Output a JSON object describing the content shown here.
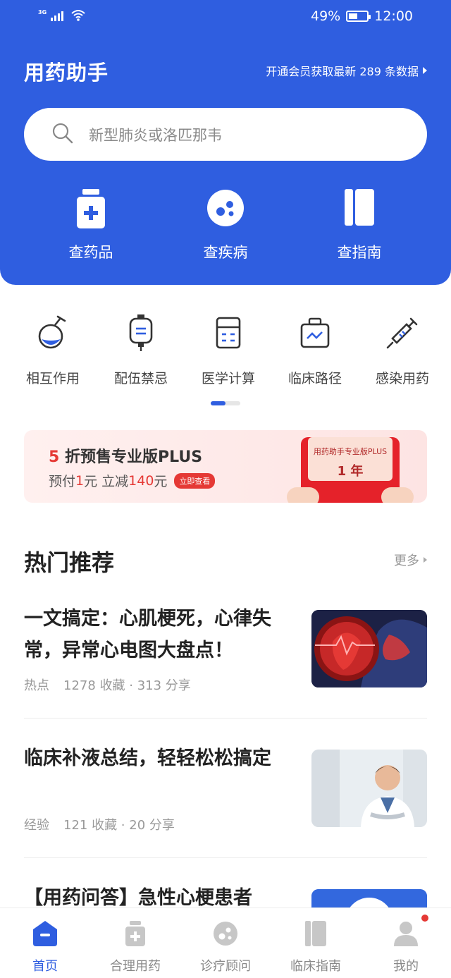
{
  "status_bar": {
    "network": "3G",
    "battery": "49%",
    "time": "12:00",
    "battery_level": 0.49
  },
  "header": {
    "app_title": "用药助手",
    "member_link": "开通会员获取最新 289 条数据"
  },
  "search": {
    "placeholder": "新型肺炎或洛匹那韦"
  },
  "quick_actions": [
    {
      "label": "查药品",
      "icon": "medicine-bottle-icon"
    },
    {
      "label": "查疾病",
      "icon": "virus-icon"
    },
    {
      "label": "查指南",
      "icon": "book-icon"
    }
  ],
  "tools": [
    {
      "label": "相互作用",
      "icon": "flask-icon"
    },
    {
      "label": "配伍禁忌",
      "icon": "iv-bag-icon"
    },
    {
      "label": "医学计算",
      "icon": "calculator-icon"
    },
    {
      "label": "临床路径",
      "icon": "kit-icon"
    },
    {
      "label": "感染用药",
      "icon": "syringe-icon"
    }
  ],
  "pager": {
    "pages": 2,
    "current": 1
  },
  "promo": {
    "discount": "5",
    "title_rest": " 折预售专业版PLUS",
    "prepay_pre": "预付 ",
    "prepay_amount": "1",
    "prepay_mid": " 元 立减 ",
    "reduce_amount": "140",
    "prepay_post": " 元",
    "badge": "立即查看",
    "card_title": "用药助手专业版PLUS",
    "card_term": "1 年"
  },
  "section": {
    "title": "热门推荐",
    "more": "更多"
  },
  "articles": [
    {
      "title": "一文搞定：心肌梗死，心律失常，异常心电图大盘点！",
      "tag": "热点",
      "stats": "1278 收藏 · 313 分享"
    },
    {
      "title": "临床补液总结，轻轻松松搞定",
      "tag": "经验",
      "stats": "121 收藏 · 20 分享"
    },
    {
      "title": "【用药问答】急性心梗患者"
    }
  ],
  "tabbar": [
    {
      "label": "首页",
      "icon": "home-icon",
      "active": true
    },
    {
      "label": "合理用药",
      "icon": "medicine-icon",
      "active": false
    },
    {
      "label": "诊疗顾问",
      "icon": "consult-icon",
      "active": false
    },
    {
      "label": "临床指南",
      "icon": "guide-icon",
      "active": false
    },
    {
      "label": "我的",
      "icon": "profile-icon",
      "active": false
    }
  ],
  "colors": {
    "primary": "#2f5ee0",
    "accent_red": "#e53935",
    "text": "#222222",
    "muted": "#999999"
  }
}
